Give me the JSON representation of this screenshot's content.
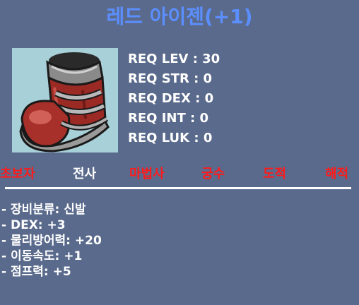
{
  "item": {
    "name": "레드 아이젠(+1)",
    "icon": "red-boots-icon"
  },
  "requirements": [
    "REQ LEV : 30",
    "REQ STR : 0",
    "REQ DEX : 0",
    "REQ INT : 0",
    "REQ LUK : 0"
  ],
  "jobs": [
    {
      "label": "초보자",
      "color": "#ff1a1a"
    },
    {
      "label": "전사",
      "color": "#ffffff"
    },
    {
      "label": "마법사",
      "color": "#ff1a1a"
    },
    {
      "label": "궁수",
      "color": "#ff1a1a"
    },
    {
      "label": "도적",
      "color": "#ff1a1a"
    },
    {
      "label": "해적",
      "color": "#ff1a1a"
    }
  ],
  "stats": [
    "- 장비분류: 신발",
    "- DEX: +3",
    "- 물리방어력: +20",
    "- 이동속도: +1",
    "- 점프력: +5"
  ],
  "colors": {
    "background": "#5a6a8c",
    "title": "#5b8fff",
    "icon_frame": "#a8d0d8"
  }
}
